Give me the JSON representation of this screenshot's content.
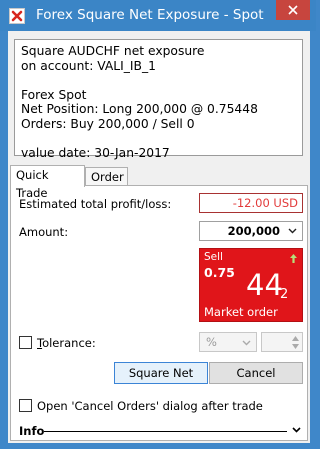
{
  "window": {
    "title": "Forex Square Net Exposure - Spot",
    "app_icon": "red-x-app-icon",
    "close_icon": "close-icon"
  },
  "summary": {
    "lines": [
      "Square AUDCHF net exposure",
      "on account: VALI_IB_1",
      "",
      "Forex Spot",
      "Net Position: Long 200,000 @ 0.75448",
      "Orders: Buy 200,000 / Sell 0",
      "",
      "value date: 30-Jan-2017"
    ]
  },
  "tabs": [
    {
      "label": "Quick Trade",
      "active": true
    },
    {
      "label": "Order",
      "active": false
    }
  ],
  "quick_trade": {
    "estimated_pl_label": "Estimated total profit/loss:",
    "estimated_pl_value": "-12.00 USD",
    "amount_label": "Amount:",
    "amount_value": "200,000",
    "sell_tile": {
      "label": "Sell",
      "big_figure": "0.75",
      "pips": "44",
      "fractional": "2",
      "footer": "Market order",
      "trend_icon": "up-arrow-icon",
      "color": "#e0151a"
    },
    "tolerance_label": "Tolerance:",
    "tolerance_checked": false,
    "tolerance_unit": "%",
    "tolerance_value": "",
    "square_net_label": "Square Net",
    "cancel_label": "Cancel",
    "open_cancel_orders_label": "Open 'Cancel Orders' dialog after trade",
    "open_cancel_orders_checked": false,
    "info_label": "Info"
  },
  "colors": {
    "titlebar": "#3b85c6",
    "close_button": "#c7453e",
    "loss_text": "#e23b3b"
  }
}
